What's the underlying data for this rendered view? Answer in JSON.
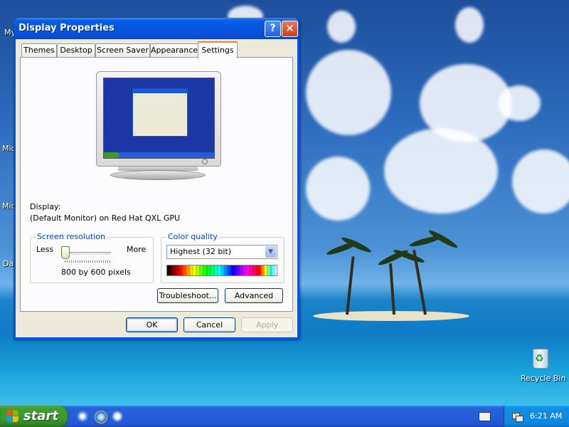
{
  "window": {
    "title": "Display Properties",
    "help_label": "?",
    "close_label": "✕"
  },
  "tabs": [
    {
      "label": "Themes"
    },
    {
      "label": "Desktop"
    },
    {
      "label": "Screen Saver"
    },
    {
      "label": "Appearance"
    },
    {
      "label": "Settings",
      "active": true
    }
  ],
  "display": {
    "label": "Display:",
    "device": "(Default Monitor) on Red Hat QXL GPU"
  },
  "resolution": {
    "group_title": "Screen resolution",
    "less_label": "Less",
    "more_label": "More",
    "value_text": "800 by 600 pixels",
    "slider_level": 0
  },
  "color_quality": {
    "group_title": "Color quality",
    "selected": "Highest (32 bit)"
  },
  "buttons": {
    "troubleshoot": "Troubleshoot...",
    "advanced": "Advanced",
    "ok": "OK",
    "cancel": "Cancel",
    "apply": "Apply"
  },
  "desktop": {
    "icons_partial": [
      "My",
      "Mic",
      "Mic",
      "Da"
    ],
    "recycle_bin": "Recycle Bin"
  },
  "taskbar": {
    "start_label": "start",
    "clock": "6:21 AM"
  },
  "colors": {
    "titlebar": "#0554e0",
    "taskbar": "#245edb",
    "start_button": "#3a9a2e",
    "group_title": "#0046d5"
  }
}
